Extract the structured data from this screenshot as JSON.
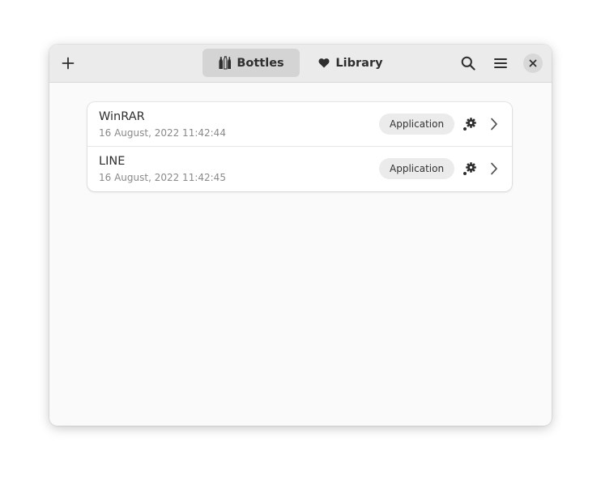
{
  "header": {
    "tabs": [
      {
        "label": "Bottles",
        "icon": "bottles-icon",
        "active": true
      },
      {
        "label": "Library",
        "icon": "heart-icon",
        "active": false
      }
    ],
    "buttons": {
      "add": "plus-icon",
      "search": "search-icon",
      "menu": "hamburger-menu-icon",
      "close": "close-icon"
    }
  },
  "bottles": [
    {
      "name": "WinRAR",
      "date": "16 August, 2022 11:42:44",
      "environment": "Application"
    },
    {
      "name": "LINE",
      "date": "16 August, 2022 11:42:45",
      "environment": "Application"
    }
  ],
  "colors": {
    "headerbar": "#ebebeb",
    "window": "#fafafa",
    "active_tab": "#d4d4d4",
    "badge": "#ebebeb",
    "text": "#2e2e2e",
    "subtext": "#8a8a8a"
  }
}
